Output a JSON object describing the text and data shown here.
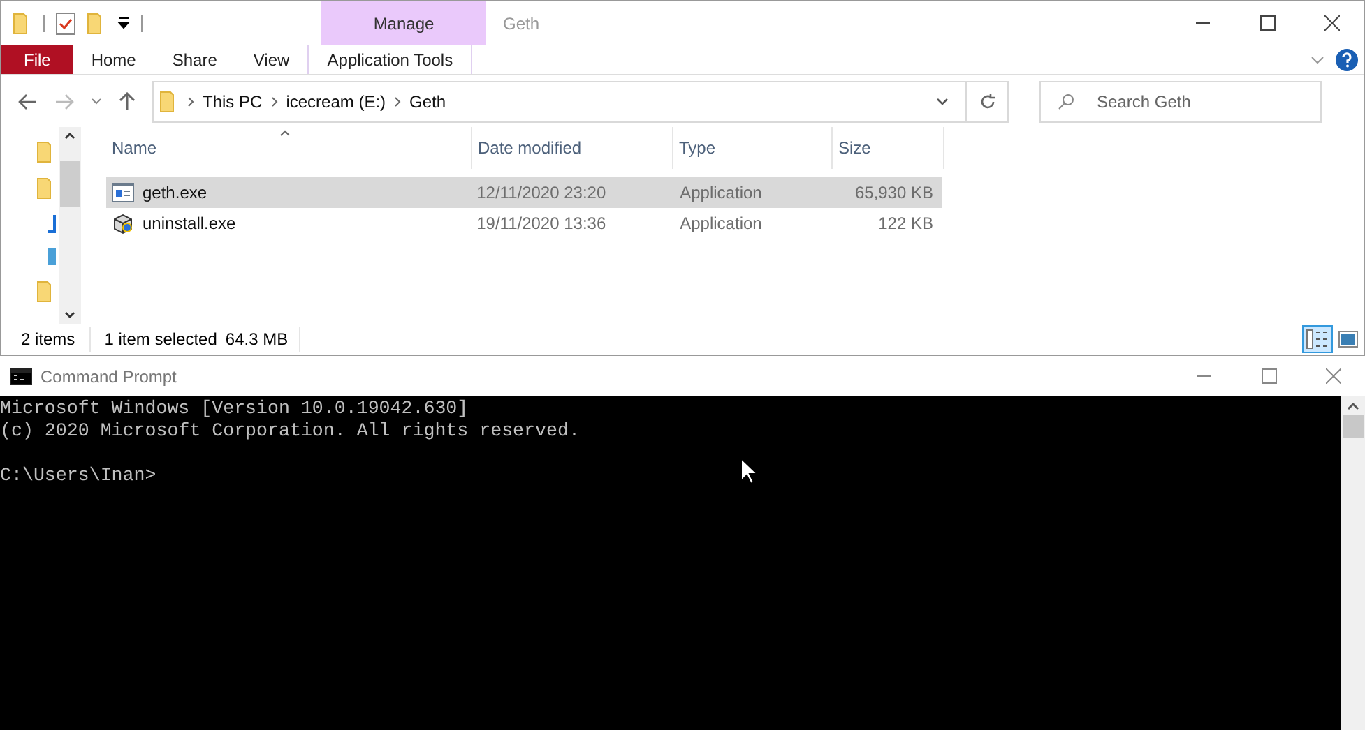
{
  "explorer": {
    "title": "Geth",
    "contextual_group": "Manage",
    "ribbon_tabs": [
      {
        "label": "File",
        "kind": "file"
      },
      {
        "label": "Home",
        "kind": "normal"
      },
      {
        "label": "Share",
        "kind": "normal"
      },
      {
        "label": "View",
        "kind": "normal"
      },
      {
        "label": "Application Tools",
        "kind": "contextual"
      }
    ],
    "breadcrumbs": [
      "This PC",
      "icecream (E:)",
      "Geth"
    ],
    "search": {
      "placeholder": "Search Geth"
    },
    "columns": [
      "Name",
      "Date modified",
      "Type",
      "Size"
    ],
    "rows": [
      {
        "name": "geth.exe",
        "date": "12/11/2020 23:20",
        "type": "Application",
        "size": "65,930 KB",
        "selected": true,
        "kind": "window"
      },
      {
        "name": "uninstall.exe",
        "date": "19/11/2020 13:36",
        "type": "Application",
        "size": "122 KB",
        "selected": false,
        "kind": "installer"
      }
    ],
    "status": {
      "count": "2 items",
      "selection": "1 item selected",
      "selection_size": "64.3 MB"
    }
  },
  "console": {
    "title": "Command Prompt",
    "lines": [
      "Microsoft Windows [Version 10.0.19042.630]",
      "(c) 2020 Microsoft Corporation. All rights reserved."
    ],
    "prompt": "C:\\Users\\Inan>"
  }
}
